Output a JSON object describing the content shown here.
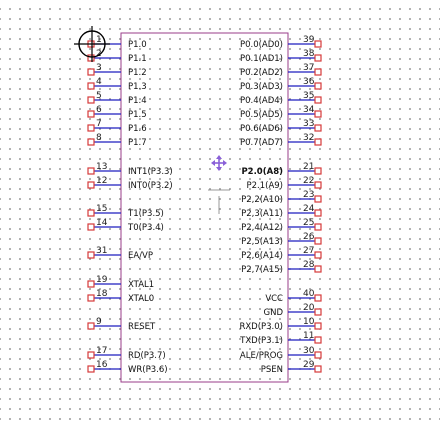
{
  "component": {
    "colors": {
      "body_stroke": "#9a3d8a",
      "pin_line": "#1f1fbf",
      "pin_end": "#d63a3a",
      "highlight": "#2b2bd9",
      "move_cursor": "#8a60d8"
    },
    "left_pins": [
      {
        "num": "1",
        "label": "P1.0"
      },
      {
        "num": "2",
        "label": "P1.1"
      },
      {
        "num": "3",
        "label": "P1.2"
      },
      {
        "num": "4",
        "label": "P1.3"
      },
      {
        "num": "5",
        "label": "P1.4"
      },
      {
        "num": "6",
        "label": "P1.5"
      },
      {
        "num": "7",
        "label": "P1.6"
      },
      {
        "num": "8",
        "label": "P1.7"
      },
      {
        "num": "13",
        "label": "INT1(P3.3)"
      },
      {
        "num": "12",
        "label": "INT0(P3.2)"
      },
      {
        "num": "15",
        "label": "T1(P3.5)"
      },
      {
        "num": "14",
        "label": "T0(P3.4)"
      },
      {
        "num": "31",
        "label": "EA/VP"
      },
      {
        "num": "19",
        "label": "XTAL1"
      },
      {
        "num": "18",
        "label": "XTAL0"
      },
      {
        "num": "9",
        "label": "RESET"
      },
      {
        "num": "17",
        "label": "RD(P3.7)"
      },
      {
        "num": "16",
        "label": "WR(P3.6)"
      }
    ],
    "right_pins": [
      {
        "num": "39",
        "label": "P0.0(AD0)"
      },
      {
        "num": "38",
        "label": "P0.1(AD1)"
      },
      {
        "num": "37",
        "label": "P0.2(AD2)"
      },
      {
        "num": "36",
        "label": "P0.3(AD3)"
      },
      {
        "num": "35",
        "label": "P0.4(AD4)"
      },
      {
        "num": "34",
        "label": "P0.5(AD5)"
      },
      {
        "num": "33",
        "label": "P0.6(AD6)"
      },
      {
        "num": "32",
        "label": "P0.7(AD7)"
      },
      {
        "num": "21",
        "label": "P2.0(A8)"
      },
      {
        "num": "22",
        "label": "P2.1(A9)"
      },
      {
        "num": "23",
        "label": "P2,2(A10)"
      },
      {
        "num": "24",
        "label": "P2,3(A11)"
      },
      {
        "num": "25",
        "label": "P2,4(A12)"
      },
      {
        "num": "26",
        "label": "P2,5(A13)"
      },
      {
        "num": "27",
        "label": "P2,6(A14)"
      },
      {
        "num": "28",
        "label": "P2,7(A15)"
      },
      {
        "num": "40",
        "label": "VCC"
      },
      {
        "num": "20",
        "label": "GND"
      },
      {
        "num": "10",
        "label": "RXD(P3.0)"
      },
      {
        "num": "11",
        "label": "TXD(P3.1)"
      },
      {
        "num": "30",
        "label": "ALE/PROG"
      },
      {
        "num": "29",
        "label": "PSEN"
      }
    ]
  }
}
